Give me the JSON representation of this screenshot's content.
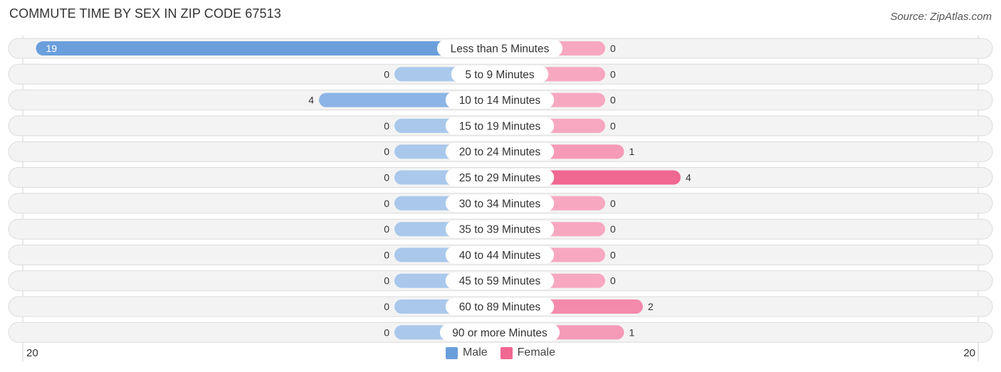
{
  "header": {
    "title": "COMMUTE TIME BY SEX IN ZIP CODE 67513",
    "source": "Source: ZipAtlas.com"
  },
  "chart_data": {
    "type": "bar",
    "orientation": "horizontal-diverging",
    "title": "COMMUTE TIME BY SEX IN ZIP CODE 67513",
    "categories": [
      "Less than 5 Minutes",
      "5 to 9 Minutes",
      "10 to 14 Minutes",
      "15 to 19 Minutes",
      "20 to 24 Minutes",
      "25 to 29 Minutes",
      "30 to 34 Minutes",
      "35 to 39 Minutes",
      "40 to 44 Minutes",
      "45 to 59 Minutes",
      "60 to 89 Minutes",
      "90 or more Minutes"
    ],
    "series": [
      {
        "name": "Male",
        "color": "#6a9fdc",
        "light_color": "#a9c8ec",
        "values": [
          19,
          0,
          4,
          0,
          0,
          0,
          0,
          0,
          0,
          0,
          0,
          0
        ]
      },
      {
        "name": "Female",
        "color": "#f06792",
        "light_color": "#f7a8c0",
        "values": [
          0,
          0,
          0,
          0,
          1,
          4,
          0,
          0,
          0,
          0,
          2,
          1
        ]
      }
    ],
    "axis": {
      "left_label": "20",
      "right_label": "20",
      "max": 20
    },
    "legend": {
      "position": "bottom-center",
      "items": [
        "Male",
        "Female"
      ]
    }
  }
}
